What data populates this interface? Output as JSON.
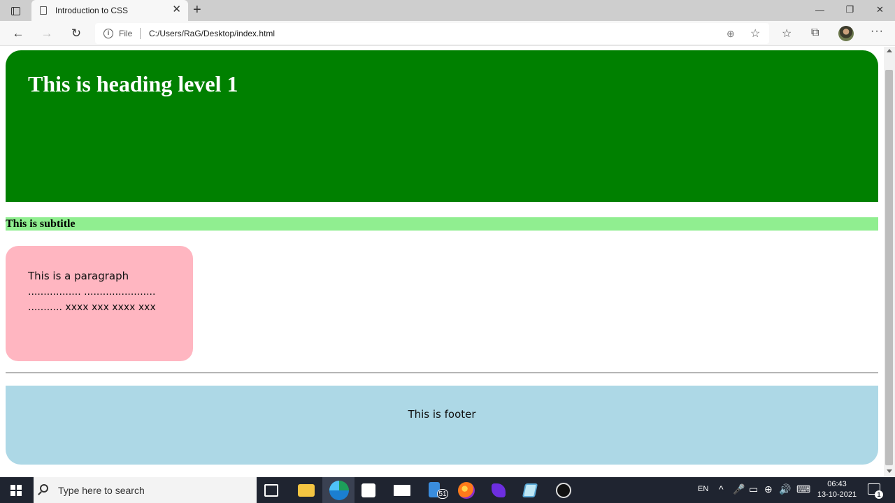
{
  "browser": {
    "tab_title": "Introduction to CSS",
    "tab_close": "✕",
    "new_tab": "+",
    "window_controls": {
      "minimize": "—",
      "restore": "❐",
      "close": "✕"
    },
    "address": {
      "scheme_label": "File",
      "url": "C:/Users/RaG/Desktop/index.html"
    },
    "nav": {
      "back": "←",
      "forward": "→",
      "reload": "↻"
    },
    "toolbar_icons": {
      "zoom": "⊕",
      "add_favorite": "☆",
      "favorites": "☆",
      "collections": "⧉",
      "more": "···"
    }
  },
  "page": {
    "heading": "This is heading level 1",
    "subtitle": "This is subtitle",
    "paragraph": {
      "line1": "This is a paragraph",
      "line2": "................. .......................",
      "line3": "........... xxxx xxx xxxx xxx"
    },
    "footer": "This is footer",
    "colors": {
      "header_bg": "#008000",
      "subtitle_bg": "#90ee90",
      "paragraph_bg": "#ffb6c1",
      "footer_bg": "#add8e6"
    }
  },
  "taskbar": {
    "search_placeholder": "Type here to search",
    "phone_badge": "51",
    "tray": {
      "language": "EN",
      "up_arrow": "^",
      "mic": "🎤",
      "battery": "▭",
      "network": "⊕",
      "volume": "🔊",
      "keyboard": "⌨"
    },
    "clock": {
      "time": "06:43",
      "date": "13-10-2021"
    },
    "notification_count": "1"
  }
}
